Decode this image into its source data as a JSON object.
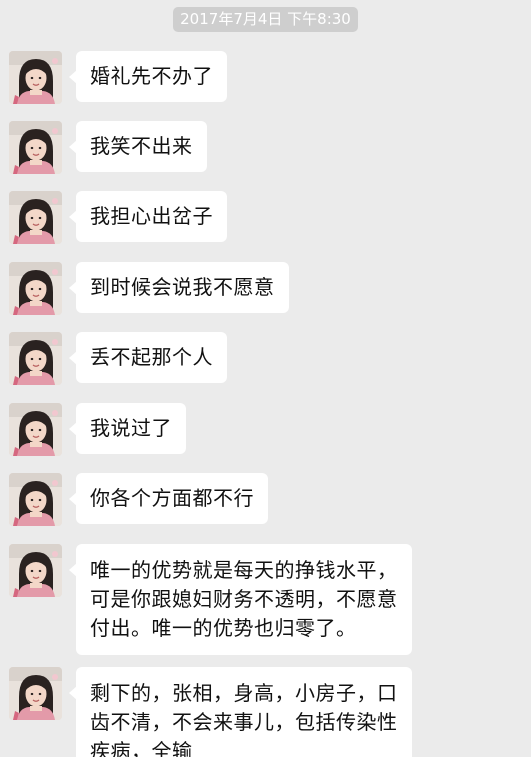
{
  "timestamp": "2017年7月4日 下午8:30",
  "messages": [
    {
      "lines": [
        "婚礼先不办了"
      ]
    },
    {
      "lines": [
        "我笑不出来"
      ]
    },
    {
      "lines": [
        "我担心出岔子"
      ]
    },
    {
      "lines": [
        "到时候会说我不愿意"
      ]
    },
    {
      "lines": [
        "丢不起那个人"
      ]
    },
    {
      "lines": [
        "我说过了"
      ]
    },
    {
      "lines": [
        "你各个方面都不行"
      ]
    },
    {
      "lines": [
        "唯一的优势就是每天的挣钱水平，",
        "可是你跟媳妇财务不透明，不愿意",
        "付出。唯一的优势也归零了。"
      ]
    },
    {
      "lines": [
        "剩下的，张相，身高，小房子，口",
        "齿不清，不会来事儿，包括传染性",
        "疾病，全输"
      ]
    }
  ],
  "colors": {
    "background": "#ebebeb",
    "bubble": "#ffffff",
    "timestamp_bg": "#cecece"
  },
  "icons": {
    "avatar": "profile-photo-avatar"
  }
}
